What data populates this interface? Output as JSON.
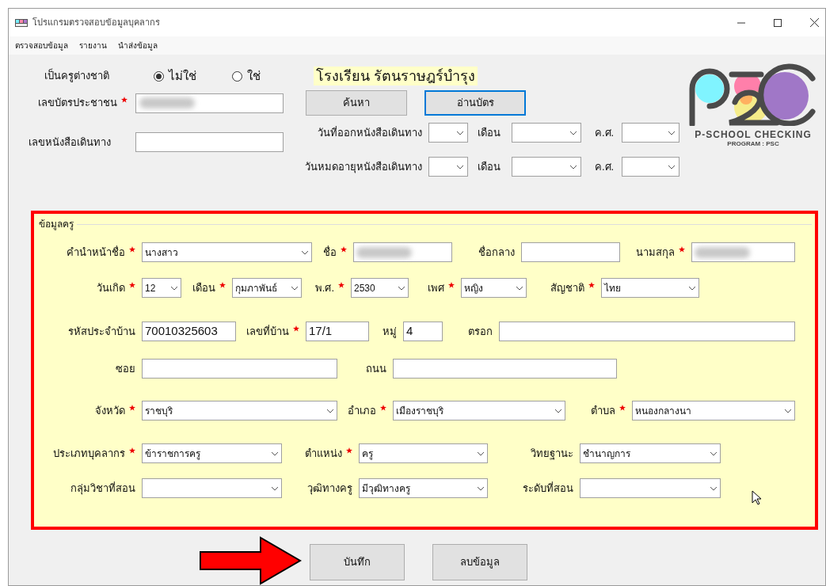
{
  "window": {
    "title": "โปรแกรมตรวจสอบข้อมูลบุคลากร"
  },
  "menu": [
    "ตรวจสอบข้อมูล",
    "รายงาน",
    "นำส่งข้อมูล"
  ],
  "foreign_teacher": {
    "label": "เป็นครูต่างชาติ",
    "options": [
      {
        "label": "ไม่ใช่",
        "selected": true
      },
      {
        "label": "ใช่",
        "selected": false
      }
    ]
  },
  "school_name": "โรงเรียน รัตนราษฎร์บำรุง",
  "id_card": {
    "label": "เลขบัตรประชาชน",
    "required": true,
    "redacted": true
  },
  "top_buttons": [
    {
      "label": "ค้นหา",
      "focused": false
    },
    {
      "label": "อ่านบัตร",
      "focused": true
    }
  ],
  "passport": {
    "label": "เลขหนังสือเดินทาง",
    "redacted": false
  },
  "passport_dates": [
    {
      "label": "วันที่ออกหนังสือเดินทาง",
      "month_label": "เดือน",
      "year_label": "ค.ศ."
    },
    {
      "label": "วันหมดอายุหนังสือเดินทาง",
      "month_label": "เดือน",
      "year_label": "ค.ศ."
    }
  ],
  "logo": {
    "title": "P-SCHOOL CHECKING",
    "subtitle": "PROGRAM : PSC"
  },
  "teacher_section": {
    "title": "ข้อมูลครู",
    "highlighted": true,
    "rows": [
      [
        {
          "label": "คำนำหน้าชื่อ",
          "required": true,
          "kind": "select",
          "value": "นางสาว",
          "redacted": false
        },
        {
          "label": "ชื่อ",
          "required": true,
          "kind": "text",
          "redacted": true
        },
        {
          "label": "ชื่อกลาง",
          "required": false,
          "kind": "text",
          "redacted": false
        },
        {
          "label": "นามสกุล",
          "required": true,
          "kind": "text",
          "redacted": true
        }
      ],
      [
        {
          "label": "วันเกิด",
          "required": true,
          "kind": "select",
          "value": "12",
          "redacted": false
        },
        {
          "label": "เดือน",
          "required": true,
          "kind": "select",
          "value": "กุมภาพันธ์",
          "redacted": false
        },
        {
          "label": "พ.ศ.",
          "required": true,
          "kind": "select",
          "value": "2530",
          "redacted": false
        },
        {
          "label": "เพศ",
          "required": true,
          "kind": "select",
          "value": "หญิง",
          "redacted": false
        },
        {
          "label": "สัญชาติ",
          "required": true,
          "kind": "select",
          "value": "ไทย",
          "redacted": false
        }
      ],
      [
        {
          "label": "รหัสประจำบ้าน",
          "required": false,
          "kind": "text",
          "value": "70010325603",
          "redacted": false
        },
        {
          "label": "เลขที่บ้าน",
          "required": true,
          "kind": "text",
          "value": "17/1",
          "redacted": false
        },
        {
          "label": "หมู่",
          "required": false,
          "kind": "text",
          "value": "4",
          "redacted": false
        },
        {
          "label": "ตรอก",
          "required": false,
          "kind": "text",
          "redacted": false
        }
      ],
      [
        {
          "label": "ซอย",
          "required": false,
          "kind": "text",
          "redacted": false
        },
        {
          "label": "ถนน",
          "required": false,
          "kind": "text",
          "redacted": false
        }
      ],
      [
        {
          "label": "จังหวัด",
          "required": true,
          "kind": "select",
          "value": "ราชบุริ",
          "redacted": false
        },
        {
          "label": "อำเภอ",
          "required": true,
          "kind": "select",
          "value": "เมืองราชบุริ",
          "redacted": false
        },
        {
          "label": "ตำบล",
          "required": true,
          "kind": "select",
          "value": "หนองกลางนา",
          "redacted": false
        }
      ],
      [
        {
          "label": "ประเภทบุคลากร",
          "required": true,
          "kind": "select",
          "value": "ข้าราชการครู",
          "redacted": false
        },
        {
          "label": "ตำแหน่ง",
          "required": true,
          "kind": "select",
          "value": "ครู",
          "redacted": false
        },
        {
          "label": "วิทยฐานะ",
          "required": false,
          "kind": "select",
          "value": "ชำนาญการ",
          "redacted": false
        }
      ],
      [
        {
          "label": "กลุ่มวิชาที่สอน",
          "required": false,
          "kind": "select",
          "redacted": false
        },
        {
          "label": "วุฒิทางครู",
          "required": false,
          "kind": "select",
          "value": "มีวุฒิทางครู",
          "redacted": false
        },
        {
          "label": "ระดับที่สอน",
          "required": false,
          "kind": "select",
          "redacted": false
        }
      ]
    ]
  },
  "actions": [
    {
      "label": "บันทึก",
      "pointed": true
    },
    {
      "label": "ลบข้อมูล",
      "pointed": false
    }
  ]
}
